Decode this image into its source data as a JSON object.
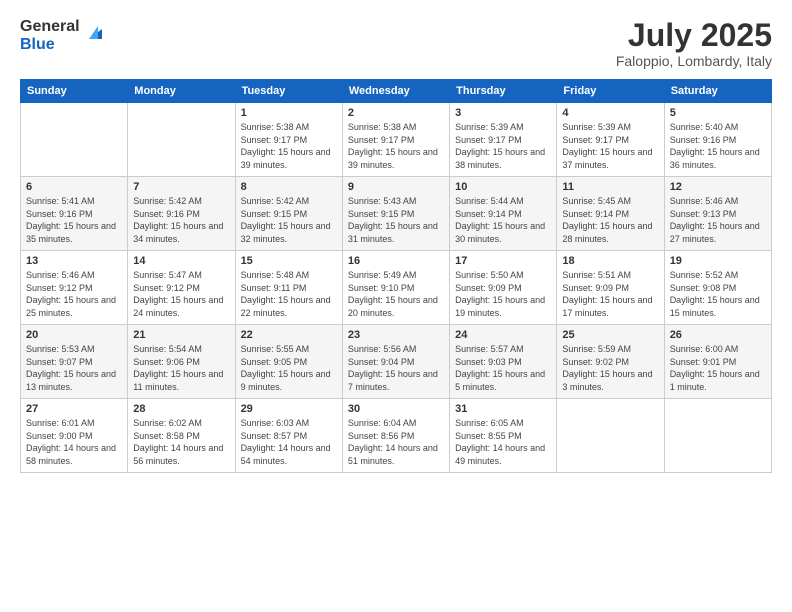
{
  "logo": {
    "general": "General",
    "blue": "Blue"
  },
  "title": "July 2025",
  "location": "Faloppio, Lombardy, Italy",
  "headers": [
    "Sunday",
    "Monday",
    "Tuesday",
    "Wednesday",
    "Thursday",
    "Friday",
    "Saturday"
  ],
  "weeks": [
    [
      {
        "day": "",
        "info": ""
      },
      {
        "day": "",
        "info": ""
      },
      {
        "day": "1",
        "info": "Sunrise: 5:38 AM\nSunset: 9:17 PM\nDaylight: 15 hours and 39 minutes."
      },
      {
        "day": "2",
        "info": "Sunrise: 5:38 AM\nSunset: 9:17 PM\nDaylight: 15 hours and 39 minutes."
      },
      {
        "day": "3",
        "info": "Sunrise: 5:39 AM\nSunset: 9:17 PM\nDaylight: 15 hours and 38 minutes."
      },
      {
        "day": "4",
        "info": "Sunrise: 5:39 AM\nSunset: 9:17 PM\nDaylight: 15 hours and 37 minutes."
      },
      {
        "day": "5",
        "info": "Sunrise: 5:40 AM\nSunset: 9:16 PM\nDaylight: 15 hours and 36 minutes."
      }
    ],
    [
      {
        "day": "6",
        "info": "Sunrise: 5:41 AM\nSunset: 9:16 PM\nDaylight: 15 hours and 35 minutes."
      },
      {
        "day": "7",
        "info": "Sunrise: 5:42 AM\nSunset: 9:16 PM\nDaylight: 15 hours and 34 minutes."
      },
      {
        "day": "8",
        "info": "Sunrise: 5:42 AM\nSunset: 9:15 PM\nDaylight: 15 hours and 32 minutes."
      },
      {
        "day": "9",
        "info": "Sunrise: 5:43 AM\nSunset: 9:15 PM\nDaylight: 15 hours and 31 minutes."
      },
      {
        "day": "10",
        "info": "Sunrise: 5:44 AM\nSunset: 9:14 PM\nDaylight: 15 hours and 30 minutes."
      },
      {
        "day": "11",
        "info": "Sunrise: 5:45 AM\nSunset: 9:14 PM\nDaylight: 15 hours and 28 minutes."
      },
      {
        "day": "12",
        "info": "Sunrise: 5:46 AM\nSunset: 9:13 PM\nDaylight: 15 hours and 27 minutes."
      }
    ],
    [
      {
        "day": "13",
        "info": "Sunrise: 5:46 AM\nSunset: 9:12 PM\nDaylight: 15 hours and 25 minutes."
      },
      {
        "day": "14",
        "info": "Sunrise: 5:47 AM\nSunset: 9:12 PM\nDaylight: 15 hours and 24 minutes."
      },
      {
        "day": "15",
        "info": "Sunrise: 5:48 AM\nSunset: 9:11 PM\nDaylight: 15 hours and 22 minutes."
      },
      {
        "day": "16",
        "info": "Sunrise: 5:49 AM\nSunset: 9:10 PM\nDaylight: 15 hours and 20 minutes."
      },
      {
        "day": "17",
        "info": "Sunrise: 5:50 AM\nSunset: 9:09 PM\nDaylight: 15 hours and 19 minutes."
      },
      {
        "day": "18",
        "info": "Sunrise: 5:51 AM\nSunset: 9:09 PM\nDaylight: 15 hours and 17 minutes."
      },
      {
        "day": "19",
        "info": "Sunrise: 5:52 AM\nSunset: 9:08 PM\nDaylight: 15 hours and 15 minutes."
      }
    ],
    [
      {
        "day": "20",
        "info": "Sunrise: 5:53 AM\nSunset: 9:07 PM\nDaylight: 15 hours and 13 minutes."
      },
      {
        "day": "21",
        "info": "Sunrise: 5:54 AM\nSunset: 9:06 PM\nDaylight: 15 hours and 11 minutes."
      },
      {
        "day": "22",
        "info": "Sunrise: 5:55 AM\nSunset: 9:05 PM\nDaylight: 15 hours and 9 minutes."
      },
      {
        "day": "23",
        "info": "Sunrise: 5:56 AM\nSunset: 9:04 PM\nDaylight: 15 hours and 7 minutes."
      },
      {
        "day": "24",
        "info": "Sunrise: 5:57 AM\nSunset: 9:03 PM\nDaylight: 15 hours and 5 minutes."
      },
      {
        "day": "25",
        "info": "Sunrise: 5:59 AM\nSunset: 9:02 PM\nDaylight: 15 hours and 3 minutes."
      },
      {
        "day": "26",
        "info": "Sunrise: 6:00 AM\nSunset: 9:01 PM\nDaylight: 15 hours and 1 minute."
      }
    ],
    [
      {
        "day": "27",
        "info": "Sunrise: 6:01 AM\nSunset: 9:00 PM\nDaylight: 14 hours and 58 minutes."
      },
      {
        "day": "28",
        "info": "Sunrise: 6:02 AM\nSunset: 8:58 PM\nDaylight: 14 hours and 56 minutes."
      },
      {
        "day": "29",
        "info": "Sunrise: 6:03 AM\nSunset: 8:57 PM\nDaylight: 14 hours and 54 minutes."
      },
      {
        "day": "30",
        "info": "Sunrise: 6:04 AM\nSunset: 8:56 PM\nDaylight: 14 hours and 51 minutes."
      },
      {
        "day": "31",
        "info": "Sunrise: 6:05 AM\nSunset: 8:55 PM\nDaylight: 14 hours and 49 minutes."
      },
      {
        "day": "",
        "info": ""
      },
      {
        "day": "",
        "info": ""
      }
    ]
  ]
}
